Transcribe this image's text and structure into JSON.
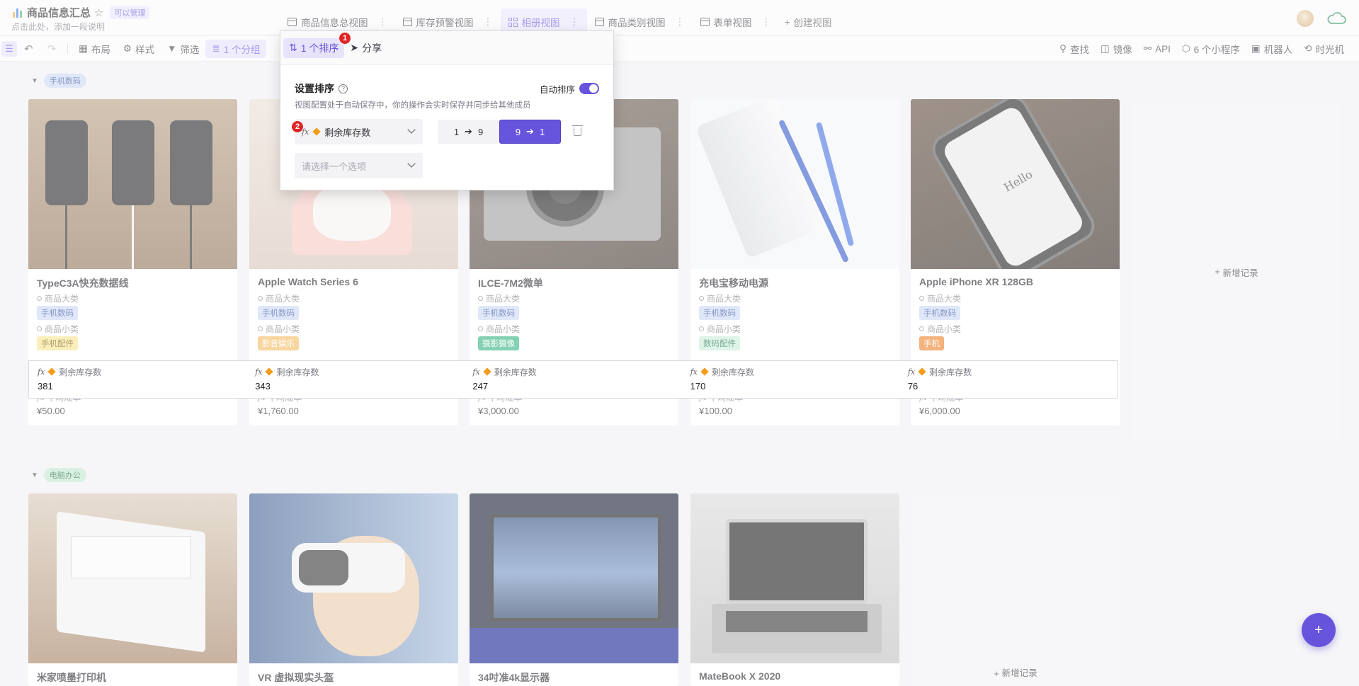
{
  "header": {
    "title": "商品信息汇总",
    "perm": "可以管理",
    "desc": "点击此处，添加一段说明",
    "tabs": [
      {
        "label": "商品信息总视图"
      },
      {
        "label": "库存预警视图"
      },
      {
        "label": "相册视图"
      },
      {
        "label": "商品类别视图"
      },
      {
        "label": "表单视图"
      }
    ],
    "add_view": "创建视图"
  },
  "toolbar": {
    "layout": "布局",
    "style": "样式",
    "filter": "筛选",
    "group": "1 个分组",
    "sort": "1 个排序",
    "share": "分享",
    "find": "查找",
    "mirror": "镜像",
    "api": "API",
    "widgets": "6 个小程序",
    "robot": "机器人",
    "timemachine": "时光机"
  },
  "sort_panel": {
    "title": "设置排序",
    "auto_label": "自动排序",
    "desc": "视图配置处于自动保存中，你的操作会实时保存并同步给其他成员",
    "field": "剩余库存数",
    "placeholder": "请选择一个选项",
    "asc_from": "1",
    "asc_to": "9",
    "desc_from": "9",
    "desc_to": "1",
    "step1": "1",
    "step2": "2"
  },
  "labels": {
    "category": "商品大类",
    "subcategory": "商品小类",
    "stock": "剩余库存数",
    "cost": "平均成本",
    "add_record": "新增记录"
  },
  "groups": [
    {
      "name": "手机数码"
    },
    {
      "name": "电脑办公"
    }
  ],
  "cards": [
    {
      "title": "TypeC3A快充数据线",
      "category": "手机数码",
      "subcategory": "手机配件",
      "stock": "381",
      "cost": "¥50.00"
    },
    {
      "title": "Apple Watch Series 6",
      "category": "手机数码",
      "subcategory": "影音娱乐",
      "stock": "343",
      "cost": "¥1,760.00"
    },
    {
      "title": "ILCE-7M2微单",
      "category": "手机数码",
      "subcategory": "摄影摄像",
      "stock": "247",
      "cost": "¥3,000.00"
    },
    {
      "title": "充电宝移动电源",
      "category": "手机数码",
      "subcategory": "数码配件",
      "stock": "170",
      "cost": "¥100.00"
    },
    {
      "title": "Apple iPhone XR 128GB",
      "category": "手机数码",
      "subcategory": "手机",
      "stock": "76",
      "cost": "¥6,000.00"
    }
  ],
  "cards2": [
    {
      "title": "米家喷墨打印机"
    },
    {
      "title": "VR 虚拟现实头盔"
    },
    {
      "title": "34吋准4k显示器"
    },
    {
      "title": "MateBook X 2020"
    }
  ],
  "phone_text": "Hello",
  "fab": "+"
}
